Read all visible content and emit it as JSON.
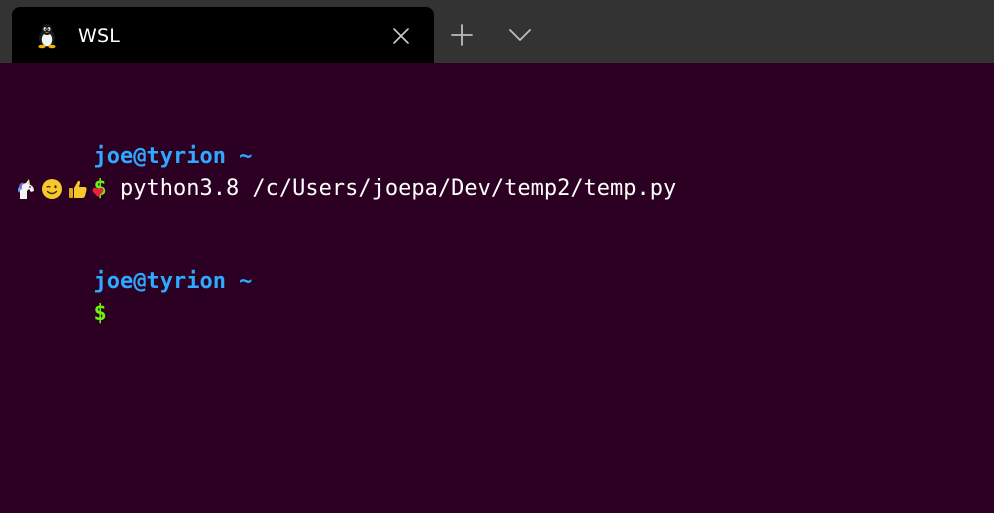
{
  "tabbar": {
    "tab": {
      "title": "WSL",
      "icon": "linux-penguin-icon",
      "close_icon": "close-icon"
    },
    "new_tab_icon": "plus-icon",
    "dropdown_icon": "chevron-down-icon",
    "colors": {
      "strip_bg": "#333333",
      "active_tab_bg": "#000000"
    }
  },
  "terminal": {
    "colors": {
      "background": "#2c0022",
      "user": "#2fa8ff",
      "dollar": "#6cf20d",
      "text": "#ffffff"
    },
    "block1": {
      "prompt": "joe@tyrion ~",
      "dollar": "$",
      "command": " python3.8 /c/Users/joepa/Dev/temp2/temp.py",
      "output_emojis": [
        "unicorn-emoji",
        "winking-face-emoji",
        "thumbs-up-emoji",
        "heart-emoji"
      ]
    },
    "block2": {
      "prompt": "joe@tyrion ~",
      "dollar": "$"
    }
  }
}
